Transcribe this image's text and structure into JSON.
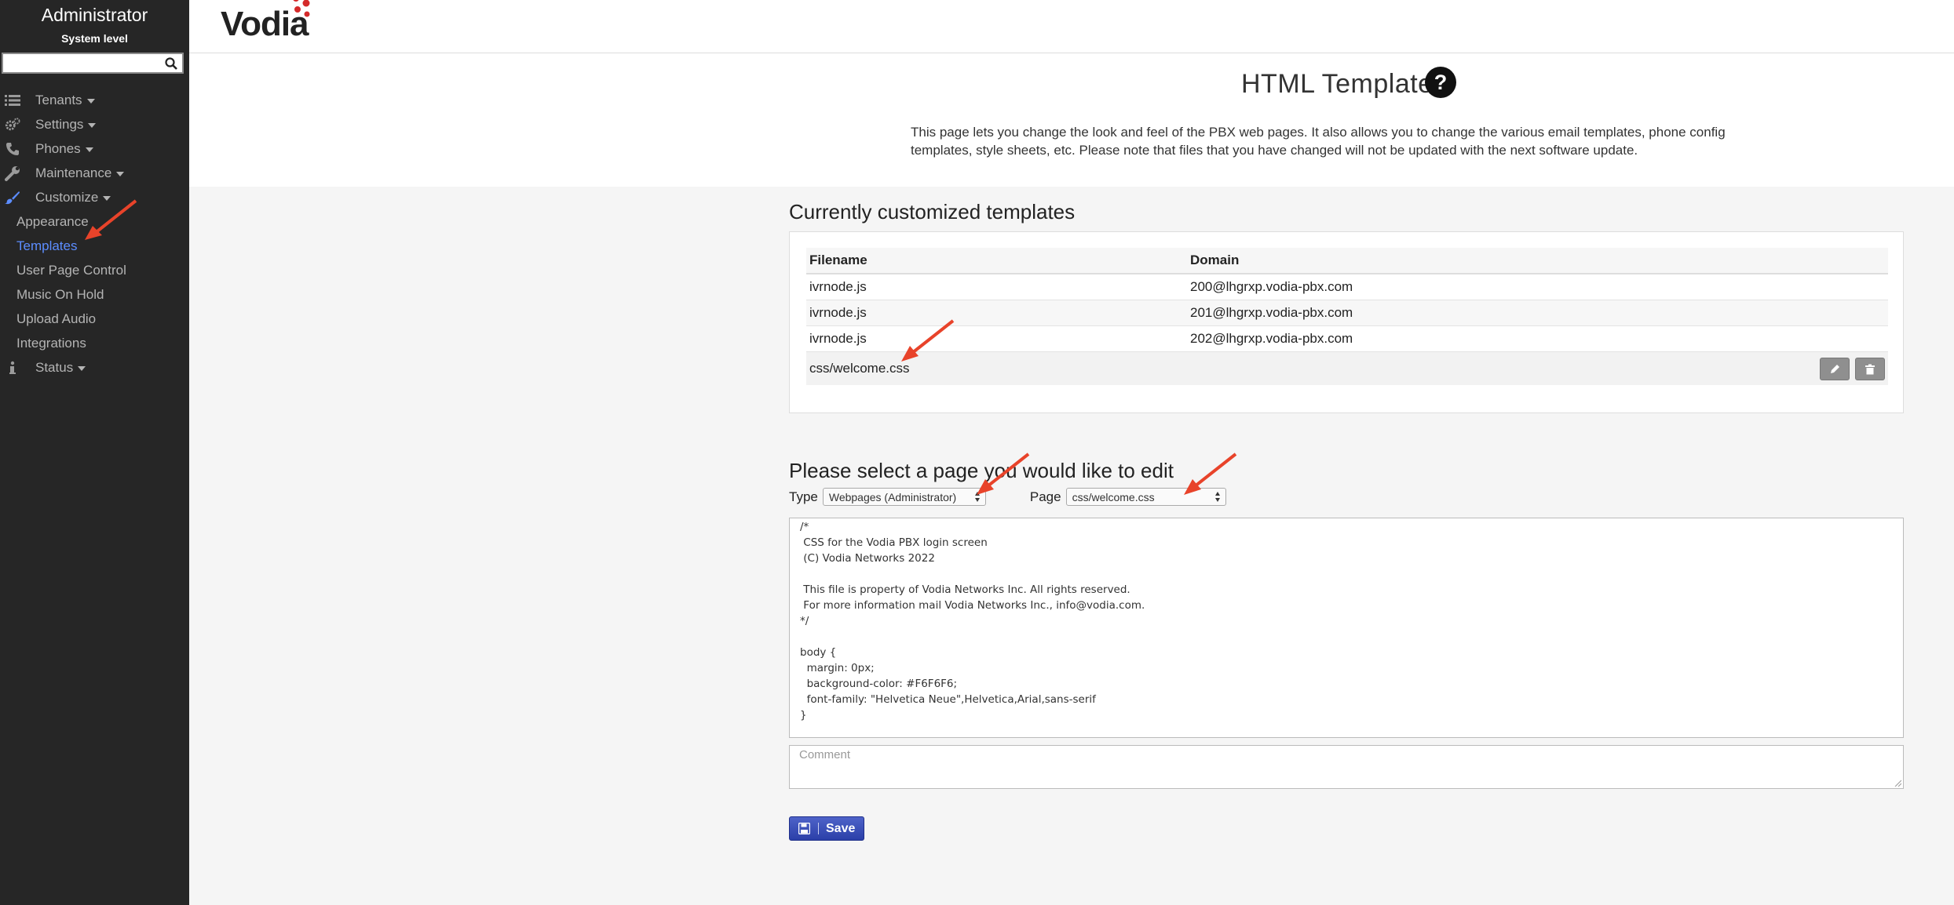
{
  "sidebar": {
    "title": "Administrator",
    "subtitle": "System level",
    "search": {
      "value": "",
      "placeholder": ""
    },
    "items": [
      {
        "label": "Tenants",
        "icon": "list-icon"
      },
      {
        "label": "Settings",
        "icon": "gears-icon"
      },
      {
        "label": "Phones",
        "icon": "phone-icon"
      },
      {
        "label": "Maintenance",
        "icon": "wrench-icon"
      },
      {
        "label": "Customize",
        "icon": "brush-icon",
        "active": true
      }
    ],
    "customize_sub": [
      {
        "label": "Appearance"
      },
      {
        "label": "Templates",
        "active": true
      },
      {
        "label": "User Page Control"
      },
      {
        "label": "Music On Hold"
      },
      {
        "label": "Upload Audio"
      },
      {
        "label": "Integrations"
      }
    ],
    "status": {
      "label": "Status",
      "icon": "info-icon"
    }
  },
  "header": {
    "logo": "Vodia"
  },
  "page": {
    "title": "HTML Templates",
    "intro": "This page lets you change the look and feel of the PBX web pages. It also allows you to change the various email templates, phone config templates, style sheets, etc. Please note that files that you have changed will not be updated with the next software update."
  },
  "customized": {
    "heading": "Currently customized templates",
    "columns": [
      "Filename",
      "Domain"
    ],
    "rows": [
      {
        "filename": "ivrnode.js",
        "domain": "200@lhgrxp.vodia-pbx.com"
      },
      {
        "filename": "ivrnode.js",
        "domain": "201@lhgrxp.vodia-pbx.com"
      },
      {
        "filename": "ivrnode.js",
        "domain": "202@lhgrxp.vodia-pbx.com"
      },
      {
        "filename": "css/welcome.css",
        "domain": ""
      }
    ]
  },
  "editor_section": {
    "heading": "Please select a page you would like to edit",
    "type_label": "Type",
    "type_value": "Webpages (Administrator)",
    "page_label": "Page",
    "page_value": "css/welcome.css",
    "content": "/*\n CSS for the Vodia PBX login screen\n (C) Vodia Networks 2022\n\n This file is property of Vodia Networks Inc. All rights reserved.\n For more information mail Vodia Networks Inc., info@vodia.com.\n*/\n\nbody {\n  margin: 0px;\n  background-color: #F6F6F6;\n  font-family: \"Helvetica Neue\",Helvetica,Arial,sans-serif\n}",
    "comment_placeholder": "Comment",
    "save_label": "Save"
  },
  "colors": {
    "sidebar_bg": "#262626",
    "active_link": "#5c8dff",
    "save_button": "#3449b5",
    "annotation_arrow": "#e8432a"
  }
}
